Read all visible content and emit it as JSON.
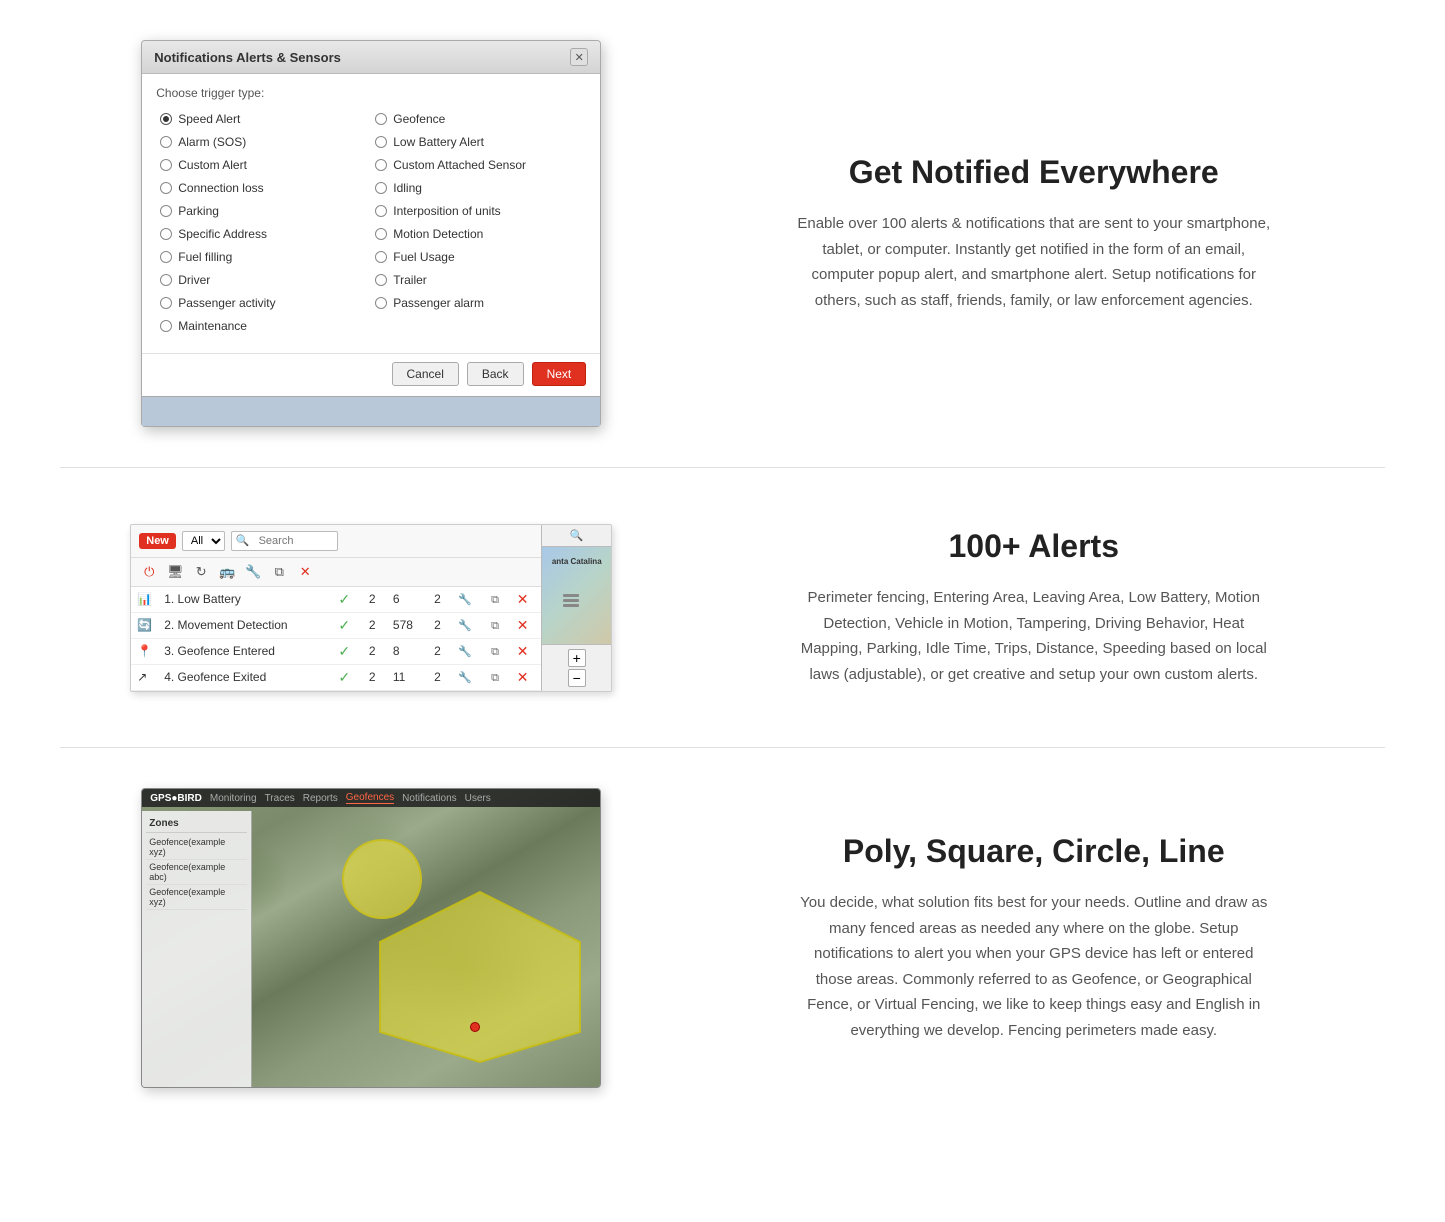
{
  "section1": {
    "title": "Get Notified Everywhere",
    "description": "Enable over 100 alerts & notifications that are sent to your smartphone, tablet, or computer. Instantly get notified in the form of an email, computer popup alert, and smartphone alert. Setup notifications for others, such as staff, friends, family, or law enforcement agencies.",
    "dialog": {
      "title": "Notifications Alerts & Sensors",
      "trigger_label": "Choose trigger type:",
      "options_left": [
        "Speed Alert",
        "Alarm (SOS)",
        "Custom Alert",
        "Connection loss",
        "Parking",
        "Specific Address",
        "Fuel filling",
        "Driver",
        "Passenger activity",
        "Maintenance"
      ],
      "options_right": [
        "Geofence",
        "Low Battery Alert",
        "Custom Attached Sensor",
        "Idling",
        "Interposition of units",
        "Motion Detection",
        "Fuel Usage",
        "Trailer",
        "Passenger alarm"
      ],
      "selected": "Speed Alert",
      "buttons": {
        "cancel": "Cancel",
        "back": "Back",
        "next": "Next"
      }
    }
  },
  "section2": {
    "title": "100+ Alerts",
    "description": "Perimeter fencing, Entering Area, Leaving Area, Low Battery, Motion Detection, Vehicle in Motion, Tampering, Driving Behavior, Heat Mapping, Parking, Idle Time, Trips, Distance, Speeding based on local laws (adjustable), or get creative and setup your own custom alerts.",
    "panel": {
      "new_badge": "New",
      "filter_placeholder": "All",
      "search_placeholder": "Search",
      "rows": [
        {
          "icon": "battery-icon",
          "label": "1. Low Battery",
          "check": true,
          "col1": "2",
          "col2": "6",
          "col3": "2"
        },
        {
          "icon": "movement-icon",
          "label": "2. Movement Detection",
          "check": true,
          "col1": "2",
          "col2": "578",
          "col3": "2"
        },
        {
          "icon": "geofence-enter-icon",
          "label": "3. Geofence Entered",
          "check": true,
          "col1": "2",
          "col2": "8",
          "col3": "2"
        },
        {
          "icon": "geofence-exit-icon",
          "label": "4. Geofence Exited",
          "check": true,
          "col1": "2",
          "col2": "11",
          "col3": "2"
        }
      ],
      "map_label": "anta Catalina"
    }
  },
  "section3": {
    "title": "Poly, Square, Circle, Line",
    "description": "You decide, what solution fits best for your needs. Outline and draw as many fenced areas as needed any where on the globe. Setup notifications to alert you when your GPS device has left or entered those areas. Commonly referred to as Geofence, or Geographical Fence, or Virtual Fencing, we like to keep things easy and English in everything we develop. Fencing perimeters made easy.",
    "geo_map": {
      "overlay_tabs": [
        "Monitoring",
        "Traces",
        "Reports",
        "Geofences",
        "Notifications",
        "Users"
      ],
      "sidebar_rows": [
        "Geofence(example xyz)",
        "Geofence(example abc)",
        "Geofence(example xyz)"
      ]
    }
  }
}
